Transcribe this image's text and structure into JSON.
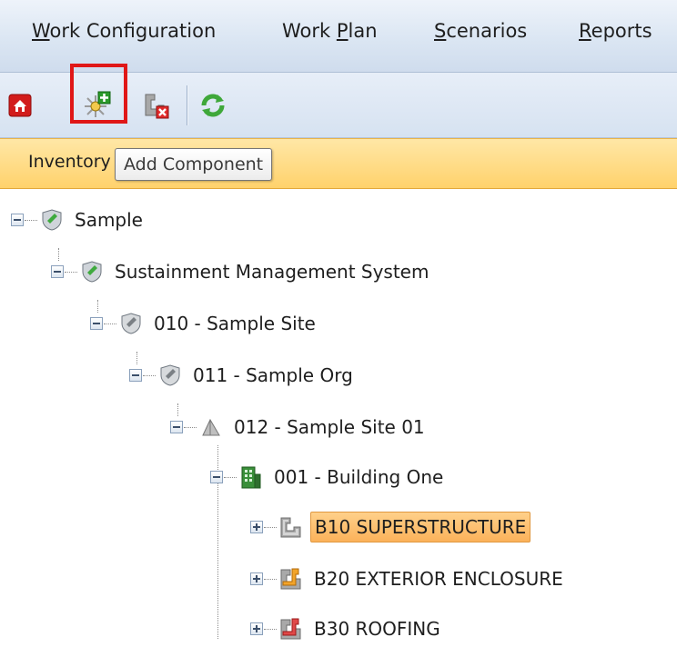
{
  "menu": {
    "items": [
      {
        "pre": "",
        "accel": "W",
        "post": "ork Configuration"
      },
      {
        "pre": "Work ",
        "accel": "P",
        "post": "lan"
      },
      {
        "pre": "",
        "accel": "S",
        "post": "cenarios"
      },
      {
        "pre": "",
        "accel": "R",
        "post": "eports"
      }
    ]
  },
  "toolbar": {
    "buttons": [
      {
        "icon": "home-icon"
      },
      {
        "icon": "add-component-icon"
      },
      {
        "icon": "delete-component-icon"
      },
      {
        "icon": "refresh-icon"
      }
    ]
  },
  "inventory": {
    "label": "Inventory"
  },
  "tooltip": {
    "text": "Add Component"
  },
  "tree": {
    "nodes": [
      {
        "label": "Sample",
        "icon": "shield-green-icon"
      },
      {
        "label": "Sustainment Management System",
        "icon": "shield-green-icon"
      },
      {
        "label": "010 - Sample Site",
        "icon": "shield-gray-icon"
      },
      {
        "label": "011 - Sample Org",
        "icon": "shield-gray-icon"
      },
      {
        "label": "012 - Sample Site 01",
        "icon": "flag-icon"
      },
      {
        "label": "001 - Building One",
        "icon": "building-icon"
      },
      {
        "label": "B10 SUPERSTRUCTURE",
        "icon": "pipe-gray-icon",
        "selected": true
      },
      {
        "label": "B20 EXTERIOR ENCLOSURE",
        "icon": "pipe-orange-icon"
      },
      {
        "label": "B30 ROOFING",
        "icon": "pipe-red-icon"
      }
    ]
  },
  "colors": {
    "menubar": "#dbe6f3",
    "inventory_bar": "#ffd26c",
    "selection": "#fbb25a",
    "highlight": "#e01717"
  }
}
